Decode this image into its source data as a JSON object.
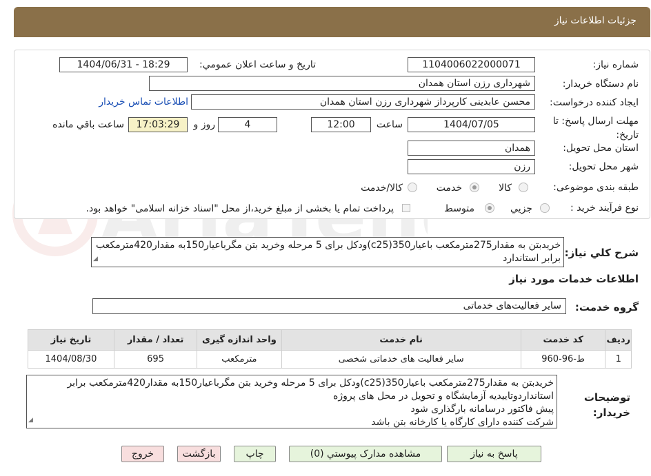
{
  "header": {
    "title": "جزئیات اطلاعات نیاز"
  },
  "form": {
    "need_number_label": "شماره نیاز:",
    "need_number": "1104006022000071",
    "announce_label": "تاریخ و ساعت اعلان عمومي:",
    "announce_value": "1404/06/31 - 18:29",
    "buyer_org_label": "نام دستگاه خریدار:",
    "buyer_org": "شهرداری رزن استان همدان",
    "creator_label": "ایجاد کننده درخواست:",
    "creator": "محسن عابدینی کارپرداز شهرداری رزن استان همدان",
    "contact_link": "اطلاعات تماس خریدار",
    "deadline_label": "مهلت ارسال پاسخ: تا تاریخ:",
    "deadline_date": "1404/07/05",
    "time_label": "ساعت",
    "deadline_time": "12:00",
    "days": "4",
    "day_and_label": "روز و",
    "remaining_time": "17:03:29",
    "remaining_label": "ساعت باقي مانده",
    "province_label": "استان محل تحویل:",
    "province": "همدان",
    "city_label": "شهر محل تحویل:",
    "city": "رزن",
    "category_label": "طبقه بندی موضوعی:",
    "category_options": [
      "کالا",
      "خدمت",
      "کالا/خدمت"
    ],
    "category_selected": "خدمت",
    "process_label": "نوع فرآیند خرید :",
    "process_options": [
      "جزيي",
      "متوسط"
    ],
    "process_selected": "متوسط",
    "payment_note": "پرداخت تمام یا بخشی از مبلغ خرید،از محل \"اسناد خزانه اسلامی\" خواهد بود."
  },
  "summary": {
    "label": "شرح کلي نياز:",
    "text": "خریدبتن به مقدار275مترمکعب باعیار350(c25)ودکل برای 5 مرحله وخرید بتن مگرباعیار150به مقدار420مترمکعب برابر استاندارد"
  },
  "services_section": {
    "title": "اطلاعات خدمات مورد نياز",
    "group_label": "گروه خدمت:",
    "group_value": "سایر فعالیت‌های خدماتی"
  },
  "table": {
    "headers": [
      "رديف",
      "کد خدمت",
      "نام خدمت",
      "واحد اندازه گیری",
      "تعداد / مقدار",
      "تاریخ نیاز"
    ],
    "rows": [
      [
        "1",
        "ط-96-960",
        "سایر فعالیت های خدماتی شخصی",
        "مترمکعب",
        "695",
        "1404/08/30"
      ]
    ]
  },
  "buyer_notes": {
    "label": "توضیحات خریدار:",
    "lines": [
      "خریدبتن به مقدار275مترمکعب باعیار350(c25)ودکل برای 5 مرحله وخرید بتن مگرباعیار150به مقدار420مترمکعب برابر",
      "استانداردوتاییدیه آزمایشگاه و تحویل در محل های پروژه",
      "پیش فاکتور درسامانه بارگذاری شود",
      "شرکت کننده دارای کارگاه یا کارخانه بتن باشد"
    ]
  },
  "buttons": {
    "reply": "پاسخ به نیاز",
    "attachments": "مشاهده مدارک پیوستي (0)",
    "print": "چاپ",
    "back": "بازگشت",
    "exit": "خروج"
  }
}
